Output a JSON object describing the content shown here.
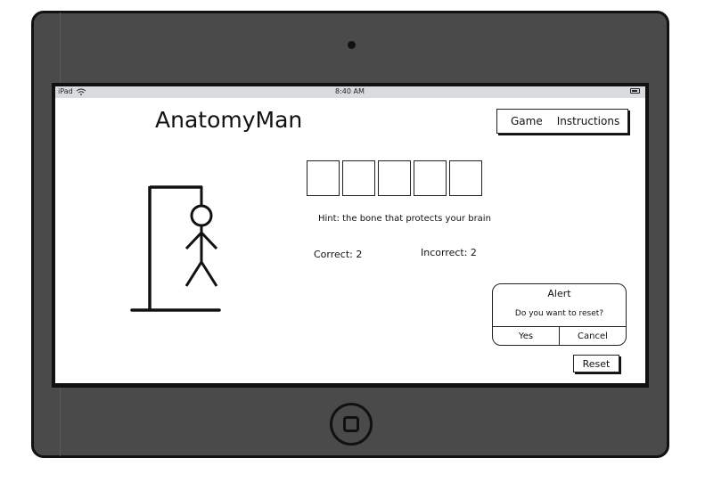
{
  "status_bar": {
    "device": "iPad",
    "time": "8:40 AM",
    "wifi_icon": "wifi-icon",
    "battery_icon": "battery-icon"
  },
  "app": {
    "title": "AnatomyMan"
  },
  "nav": {
    "items": [
      {
        "label": "Game"
      },
      {
        "label": "Instructions"
      }
    ]
  },
  "game": {
    "letter_slots": 5,
    "hint": "Hint: the bone that protects your brain",
    "correct": "Correct: 2",
    "incorrect": "Incorrect: 2"
  },
  "alert": {
    "title": "Alert",
    "message": "Do you want to reset?",
    "yes_label": "Yes",
    "cancel_label": "Cancel"
  },
  "reset_label": "Reset"
}
